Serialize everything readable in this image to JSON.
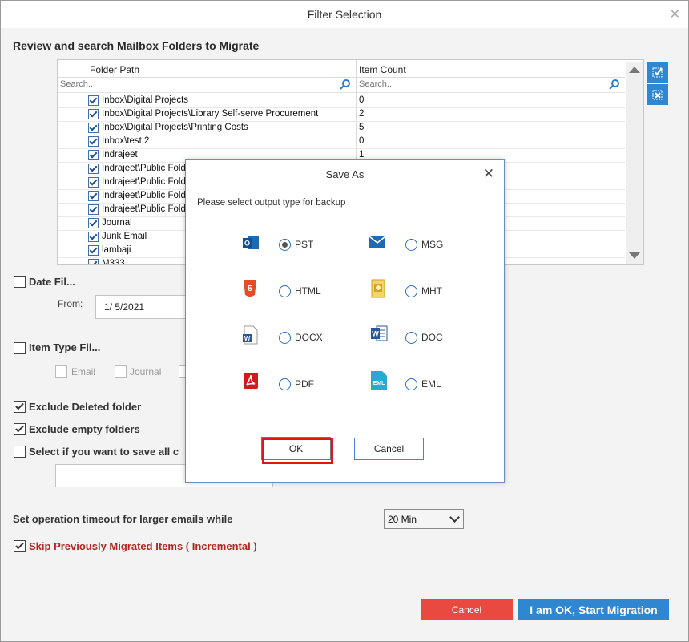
{
  "window": {
    "title": "Filter Selection"
  },
  "heading": "Review and search Mailbox Folders to Migrate",
  "grid": {
    "col_path": "Folder Path",
    "col_count": "Item Count",
    "search_placeholder_path": "Search..",
    "search_placeholder_count": "Search..",
    "rows": [
      {
        "path": "Inbox\\Digital Projects",
        "count": "0"
      },
      {
        "path": "Inbox\\Digital Projects\\Library Self-serve Procurement",
        "count": "2"
      },
      {
        "path": "Inbox\\Digital Projects\\Printing Costs",
        "count": "5"
      },
      {
        "path": "Inbox\\test 2",
        "count": "0"
      },
      {
        "path": "Indrajeet",
        "count": "1"
      },
      {
        "path": "Indrajeet\\Public Folder",
        "count": ""
      },
      {
        "path": "Indrajeet\\Public Folder",
        "count": ""
      },
      {
        "path": "Indrajeet\\Public Folder",
        "count": ""
      },
      {
        "path": "Indrajeet\\Public Folder",
        "count": ""
      },
      {
        "path": "Journal",
        "count": ""
      },
      {
        "path": "Junk Email",
        "count": ""
      },
      {
        "path": "lambaji",
        "count": ""
      },
      {
        "path": "M333",
        "count": ""
      }
    ]
  },
  "filters": {
    "date_label": "Date Fil...",
    "from_label": "From:",
    "from_value": "1/  5/2021",
    "item_type_label": "Item Type Fil...",
    "item_email": "Email",
    "item_journal": "Journal",
    "exclude_deleted": "Exclude Deleted folder",
    "exclude_empty": "Exclude empty folders",
    "save_all": "Select if you want to save all c",
    "timeout_label": "Set operation timeout for larger emails while",
    "timeout_value": "20 Min",
    "skip_label": "Skip Previously Migrated Items ( Incremental )"
  },
  "buttons": {
    "cancel": "Cancel",
    "start": "I am OK, Start Migration"
  },
  "dialog": {
    "title": "Save As",
    "prompt": "Please select output type for backup",
    "options": [
      {
        "label": "PST",
        "icon": "outlook-icon",
        "selected": true
      },
      {
        "label": "MSG",
        "icon": "envelope-icon",
        "selected": false
      },
      {
        "label": "HTML",
        "icon": "html5-icon",
        "selected": false
      },
      {
        "label": "MHT",
        "icon": "mht-file-icon",
        "selected": false
      },
      {
        "label": "DOCX",
        "icon": "docx-file-icon",
        "selected": false
      },
      {
        "label": "DOC",
        "icon": "word-icon",
        "selected": false
      },
      {
        "label": "PDF",
        "icon": "pdf-icon",
        "selected": false
      },
      {
        "label": "EML",
        "icon": "eml-file-icon",
        "selected": false
      }
    ],
    "ok": "OK",
    "cancel": "Cancel"
  },
  "colors": {
    "accent_blue": "#2f86d1",
    "cancel_red": "#e9493e",
    "highlight_red": "#e01616",
    "skip_text_red": "#b5261f"
  }
}
